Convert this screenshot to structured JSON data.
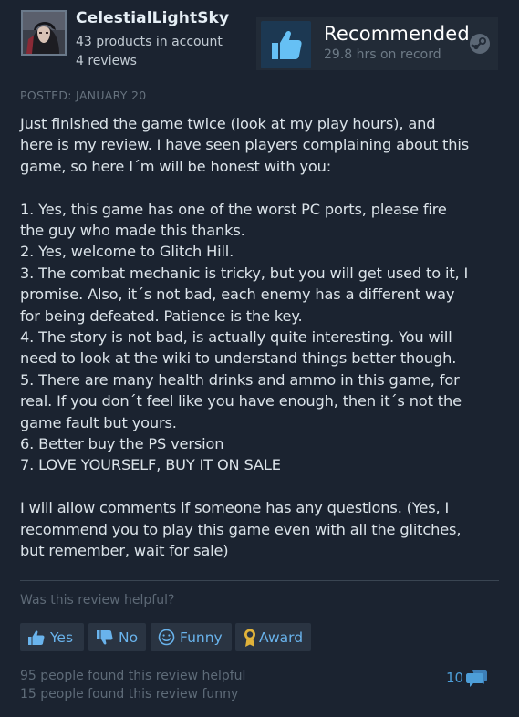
{
  "author": {
    "name": "CelestialLightSky",
    "products": "43 products in account",
    "reviews": "4 reviews"
  },
  "recommendation": {
    "title": "Recommended",
    "hours": "29.8 hrs on record",
    "icon": "thumbs-up-icon",
    "platform_icon": "steam-logo-icon"
  },
  "review": {
    "posted": "POSTED: JANUARY 20",
    "lines": [
      "Just finished the game twice (look at my play hours), and",
      "here is my review. I have seen players complaining about this",
      "game, so here I´m will be honest with you:",
      "",
      "1. Yes, this game has one of the worst PC ports, please fire",
      "the guy who made this thanks.",
      "2. Yes, welcome to Glitch Hill.",
      "3. The combat mechanic is tricky, but you will get used to it, I",
      "promise. Also, it´s not bad, each enemy has a different way",
      "for being defeated. Patience is the key.",
      "4. The story is not bad, is actually quite interesting. You will",
      "need to look at the wiki to understand things better though.",
      "5. There are many health drinks and ammo in this game, for",
      "real. If you don´t feel like you have enough, then it´s not the",
      "game fault but yours.",
      "6. Better buy the PS version",
      "7. LOVE YOURSELF, BUY IT ON SALE",
      "",
      "I will allow comments if someone has any questions. (Yes, I",
      "recommend you to play this game even with all the glitches,",
      "but remember, wait for sale)"
    ]
  },
  "feedback": {
    "question": "Was this review helpful?",
    "yes_label": "Yes",
    "no_label": "No",
    "funny_label": "Funny",
    "award_label": "Award"
  },
  "stats": {
    "helpful": "95 people found this review helpful",
    "funny": "15 people found this review funny",
    "comments_count": "10"
  },
  "colors": {
    "background": "#1b2330",
    "accent": "#69b3ec",
    "award_gold": "#e0b23a"
  }
}
